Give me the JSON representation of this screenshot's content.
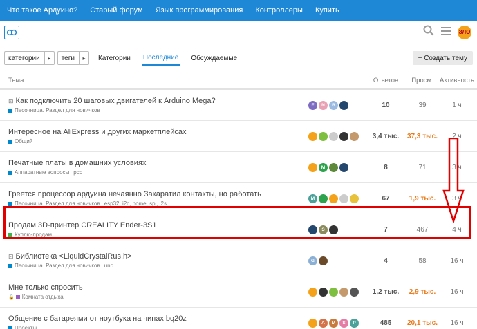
{
  "topnav": [
    "Что такое Ардуино?",
    "Старый форум",
    "Язык программирования",
    "Контроллеры",
    "Купить"
  ],
  "controls": {
    "categories_dd": "категории",
    "tags_dd": "теги",
    "links": [
      "Категории",
      "Последние",
      "Обсуждаемые"
    ],
    "create": "+ Создать тему"
  },
  "columns": {
    "topic": "Тема",
    "replies": "Ответов",
    "views": "Просм.",
    "activity": "Активность"
  },
  "me_avatar": "ЗЛО",
  "topics": [
    {
      "title": "Как подключить 20 шаговых двигателей к Arduino Mega?",
      "category": "Песочница. Раздел для новичков",
      "cat_color": "#0088cc",
      "tags": "",
      "replies": "10",
      "views": "39",
      "activity": "1 ч",
      "locked": true,
      "posters": [
        {
          "t": "F",
          "c": "#7e6bc2"
        },
        {
          "t": "N",
          "c": "#e8a1b5"
        },
        {
          "t": "B",
          "c": "#9bbbe0"
        },
        {
          "t": "",
          "c": "#24476e"
        }
      ]
    },
    {
      "title": "Интересное на AliExpress и других маркетплейсах",
      "category": "Общий",
      "cat_color": "#0088cc",
      "tags": "",
      "replies": "3,4 тыс.",
      "views": "37,3 тыс.",
      "views_hot": true,
      "activity": "2 ч",
      "posters": [
        {
          "t": "",
          "c": "#f3a21a"
        },
        {
          "t": "",
          "c": "#7fbf3f"
        },
        {
          "t": "",
          "c": "#cccccc"
        },
        {
          "t": "",
          "c": "#333333"
        },
        {
          "t": "",
          "c": "#c49a6c"
        }
      ]
    },
    {
      "title": "Печатные платы в домашних условиях",
      "category": "Аппаратные вопросы",
      "cat_color": "#0088cc",
      "tags": "pcb",
      "replies": "8",
      "views": "71",
      "activity": "3 ч",
      "posters": [
        {
          "t": "",
          "c": "#f3a21a"
        },
        {
          "t": "M",
          "c": "#2ea34e"
        },
        {
          "t": "",
          "c": "#5c8a3a"
        },
        {
          "t": "",
          "c": "#24476e"
        }
      ]
    },
    {
      "title": "Греется процессор ардуина нечаянно Закаратил контакты, но работать",
      "category": "Песочница. Раздел для новичков",
      "cat_color": "#0088cc",
      "tags": "esp32, i2c, home, spi, i2s",
      "replies": "67",
      "views": "1,9 тыс.",
      "views_hot": true,
      "activity": "3 ч",
      "posters": [
        {
          "t": "M",
          "c": "#4ca19a"
        },
        {
          "t": "",
          "c": "#2ea34e"
        },
        {
          "t": "",
          "c": "#f3a21a"
        },
        {
          "t": "",
          "c": "#cccccc"
        },
        {
          "t": "",
          "c": "#e8c23a"
        }
      ]
    },
    {
      "title": "Продам 3D-принтер CREALITY Ender-3S1",
      "category": "Куплю-продам",
      "cat_color": "#3ab54a",
      "tags": "",
      "replies": "7",
      "views": "467",
      "activity": "4 ч",
      "posters": [
        {
          "t": "",
          "c": "#24476e"
        },
        {
          "t": "S",
          "c": "#8a8a5c"
        },
        {
          "t": "",
          "c": "#333333"
        }
      ]
    },
    {
      "title": "Библиотека <LiquidCrystalRus.h>",
      "category": "Песочница. Раздел для новичков",
      "cat_color": "#0088cc",
      "tags": "uno",
      "replies": "4",
      "views": "58",
      "activity": "16 ч",
      "locked": true,
      "posters": [
        {
          "t": "G",
          "c": "#8bb0d6"
        },
        {
          "t": "",
          "c": "#6b4a2a"
        }
      ]
    },
    {
      "title": "Мне только спросить",
      "category": "Комната отдыха",
      "cat_color": "#9b5fc0",
      "tags": "",
      "replies": "1,2 тыс.",
      "views": "2,9 тыс.",
      "views_hot": true,
      "activity": "16 ч",
      "locked_meta": true,
      "posters": [
        {
          "t": "",
          "c": "#f3a21a"
        },
        {
          "t": "",
          "c": "#333333"
        },
        {
          "t": "",
          "c": "#7fbf3f"
        },
        {
          "t": "",
          "c": "#c49a6c"
        },
        {
          "t": "",
          "c": "#555555"
        }
      ]
    },
    {
      "title": "Общение с батареями от ноутбука на чипах bq20z",
      "category": "Проекты",
      "cat_color": "#0088cc",
      "tags": "",
      "replies": "485",
      "views": "20,1 тыс.",
      "views_hot": true,
      "activity": "16 ч",
      "posters": [
        {
          "t": "",
          "c": "#f3a21a"
        },
        {
          "t": "A",
          "c": "#d4734a"
        },
        {
          "t": "M",
          "c": "#c97a3c"
        },
        {
          "t": "S",
          "c": "#e57ca4"
        },
        {
          "t": "P",
          "c": "#4ca19a"
        }
      ]
    }
  ]
}
